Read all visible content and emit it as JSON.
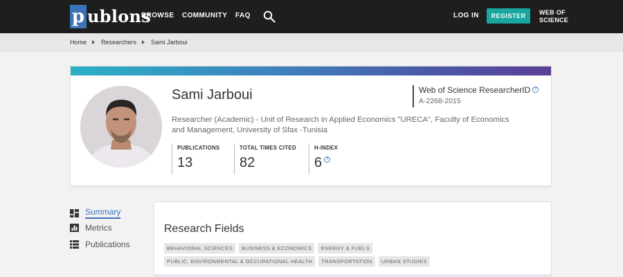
{
  "nav": {
    "logo_mark": "p",
    "logo_text": "ublons",
    "browse": "BROWSE",
    "community": "COMMUNITY",
    "faq": "FAQ",
    "login": "LOG IN",
    "register": "REGISTER",
    "wos_line1": "WEB OF",
    "wos_line2": "SCIENCE"
  },
  "breadcrumb": {
    "items": [
      "Home",
      "Researchers",
      "Sami Jarboui"
    ]
  },
  "profile": {
    "name": "Sami Jarboui",
    "affiliation": "Researcher (Academic) - Unit of Research in Applied Economics \"URECA\", Faculty of Economics and Management, University of Sfax -Tunisia",
    "researcher_id_label": "Web of Science ResearcherID",
    "researcher_id": "A-2268-2015",
    "stats": [
      {
        "label": "PUBLICATIONS",
        "value": "13"
      },
      {
        "label": "TOTAL TIMES CITED",
        "value": "82"
      },
      {
        "label": "H-INDEX",
        "value": "6"
      }
    ]
  },
  "sidenav": {
    "items": [
      {
        "label": "Summary",
        "icon": "dashboard-icon",
        "active": true
      },
      {
        "label": "Metrics",
        "icon": "bar-chart-icon",
        "active": false
      },
      {
        "label": "Publications",
        "icon": "list-icon",
        "active": false
      }
    ]
  },
  "research_fields": {
    "title": "Research Fields",
    "row1": [
      "BEHAVIORAL SCIENCES",
      "BUSINESS & ECONOMICS",
      "ENERGY & FUELS"
    ],
    "row2": [
      "PUBLIC, ENVIRONMENTAL & OCCUPATIONAL HEALTH",
      "TRANSPORTATION",
      "URBAN STUDIES"
    ]
  },
  "colors": {
    "accent_teal": "#1aa6a0",
    "link_blue": "#3b70b6",
    "topbar": "#1e1e1e"
  }
}
